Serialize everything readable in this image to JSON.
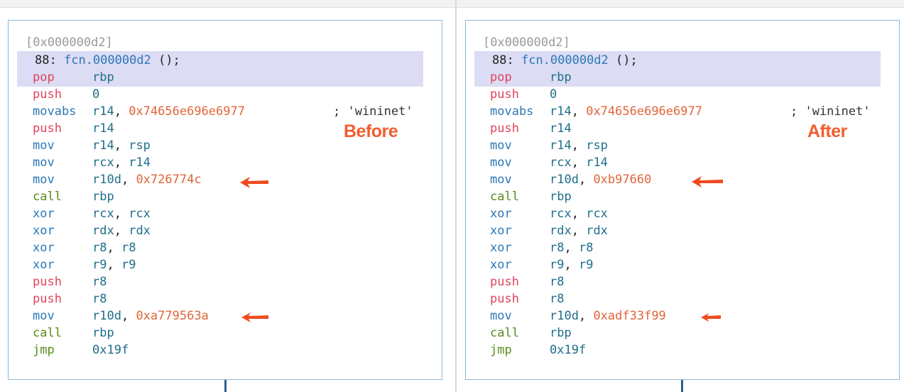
{
  "colors": {
    "red": "#e0445c",
    "blue": "#2b78b8",
    "green": "#5a8a1a",
    "reg": "#1f6f8b",
    "imm": "#e0653a",
    "text": "#222222",
    "annotation": "#f25d2e"
  },
  "panels": [
    {
      "tag": "Before",
      "address": "[0x000000d2]",
      "header": {
        "num": "88:",
        "fn": "fcn.000000d2",
        "rest": " ();"
      },
      "comment": "; 'wininet'",
      "lines": [
        {
          "op": "pop",
          "oc": "red",
          "parts": [
            [
              "rbp",
              "reg"
            ]
          ]
        },
        {
          "op": "push",
          "oc": "red",
          "parts": [
            [
              "0",
              "reg"
            ]
          ]
        },
        {
          "op": "movabs",
          "oc": "blue",
          "parts": [
            [
              "r14",
              "reg"
            ],
            [
              ", ",
              "text"
            ],
            [
              "0x74656e696e6977",
              "imm"
            ]
          ]
        },
        {
          "op": "push",
          "oc": "red",
          "parts": [
            [
              "r14",
              "reg"
            ]
          ]
        },
        {
          "op": "mov",
          "oc": "blue",
          "parts": [
            [
              "r14",
              "reg"
            ],
            [
              ", ",
              "text"
            ],
            [
              "rsp",
              "reg"
            ]
          ]
        },
        {
          "op": "mov",
          "oc": "blue",
          "parts": [
            [
              "rcx",
              "reg"
            ],
            [
              ", ",
              "text"
            ],
            [
              "r14",
              "reg"
            ]
          ]
        },
        {
          "op": "mov",
          "oc": "blue",
          "parts": [
            [
              "r10d",
              "reg"
            ],
            [
              ", ",
              "text"
            ],
            [
              "0x726774c",
              "imm"
            ]
          ]
        },
        {
          "op": "call",
          "oc": "green",
          "parts": [
            [
              "rbp",
              "reg"
            ]
          ]
        },
        {
          "op": "xor",
          "oc": "blue",
          "parts": [
            [
              "rcx",
              "reg"
            ],
            [
              ", ",
              "text"
            ],
            [
              "rcx",
              "reg"
            ]
          ]
        },
        {
          "op": "xor",
          "oc": "blue",
          "parts": [
            [
              "rdx",
              "reg"
            ],
            [
              ", ",
              "text"
            ],
            [
              "rdx",
              "reg"
            ]
          ]
        },
        {
          "op": "xor",
          "oc": "blue",
          "parts": [
            [
              "r8",
              "reg"
            ],
            [
              ", ",
              "text"
            ],
            [
              "r8",
              "reg"
            ]
          ]
        },
        {
          "op": "xor",
          "oc": "blue",
          "parts": [
            [
              "r9",
              "reg"
            ],
            [
              ", ",
              "text"
            ],
            [
              "r9",
              "reg"
            ]
          ]
        },
        {
          "op": "push",
          "oc": "red",
          "parts": [
            [
              "r8",
              "reg"
            ]
          ]
        },
        {
          "op": "push",
          "oc": "red",
          "parts": [
            [
              "r8",
              "reg"
            ]
          ]
        },
        {
          "op": "mov",
          "oc": "blue",
          "parts": [
            [
              "r10d",
              "reg"
            ],
            [
              ", ",
              "text"
            ],
            [
              "0xa779563a",
              "imm"
            ]
          ]
        },
        {
          "op": "call",
          "oc": "green",
          "parts": [
            [
              "rbp",
              "reg"
            ]
          ]
        },
        {
          "op": "jmp",
          "oc": "green",
          "parts": [
            [
              "0x19f",
              "reg"
            ]
          ]
        }
      ]
    },
    {
      "tag": "After",
      "address": "[0x000000d2]",
      "header": {
        "num": "88:",
        "fn": "fcn.000000d2",
        "rest": " ();"
      },
      "comment": "; 'wininet'",
      "lines": [
        {
          "op": "pop",
          "oc": "red",
          "parts": [
            [
              "rbp",
              "reg"
            ]
          ]
        },
        {
          "op": "push",
          "oc": "red",
          "parts": [
            [
              "0",
              "reg"
            ]
          ]
        },
        {
          "op": "movabs",
          "oc": "blue",
          "parts": [
            [
              "r14",
              "reg"
            ],
            [
              ", ",
              "text"
            ],
            [
              "0x74656e696e6977",
              "imm"
            ]
          ]
        },
        {
          "op": "push",
          "oc": "red",
          "parts": [
            [
              "r14",
              "reg"
            ]
          ]
        },
        {
          "op": "mov",
          "oc": "blue",
          "parts": [
            [
              "r14",
              "reg"
            ],
            [
              ", ",
              "text"
            ],
            [
              "rsp",
              "reg"
            ]
          ]
        },
        {
          "op": "mov",
          "oc": "blue",
          "parts": [
            [
              "rcx",
              "reg"
            ],
            [
              ", ",
              "text"
            ],
            [
              "r14",
              "reg"
            ]
          ]
        },
        {
          "op": "mov",
          "oc": "blue",
          "parts": [
            [
              "r10d",
              "reg"
            ],
            [
              ", ",
              "text"
            ],
            [
              "0xb97660",
              "imm"
            ]
          ]
        },
        {
          "op": "call",
          "oc": "green",
          "parts": [
            [
              "rbp",
              "reg"
            ]
          ]
        },
        {
          "op": "xor",
          "oc": "blue",
          "parts": [
            [
              "rcx",
              "reg"
            ],
            [
              ", ",
              "text"
            ],
            [
              "rcx",
              "reg"
            ]
          ]
        },
        {
          "op": "xor",
          "oc": "blue",
          "parts": [
            [
              "rdx",
              "reg"
            ],
            [
              ", ",
              "text"
            ],
            [
              "rdx",
              "reg"
            ]
          ]
        },
        {
          "op": "xor",
          "oc": "blue",
          "parts": [
            [
              "r8",
              "reg"
            ],
            [
              ", ",
              "text"
            ],
            [
              "r8",
              "reg"
            ]
          ]
        },
        {
          "op": "xor",
          "oc": "blue",
          "parts": [
            [
              "r9",
              "reg"
            ],
            [
              ", ",
              "text"
            ],
            [
              "r9",
              "reg"
            ]
          ]
        },
        {
          "op": "push",
          "oc": "red",
          "parts": [
            [
              "r8",
              "reg"
            ]
          ]
        },
        {
          "op": "push",
          "oc": "red",
          "parts": [
            [
              "r8",
              "reg"
            ]
          ]
        },
        {
          "op": "mov",
          "oc": "blue",
          "parts": [
            [
              "r10d",
              "reg"
            ],
            [
              ", ",
              "text"
            ],
            [
              "0xadf33f99",
              "imm"
            ]
          ]
        },
        {
          "op": "call",
          "oc": "green",
          "parts": [
            [
              "rbp",
              "reg"
            ]
          ]
        },
        {
          "op": "jmp",
          "oc": "green",
          "parts": [
            [
              "0x19f",
              "reg"
            ]
          ]
        }
      ]
    }
  ]
}
